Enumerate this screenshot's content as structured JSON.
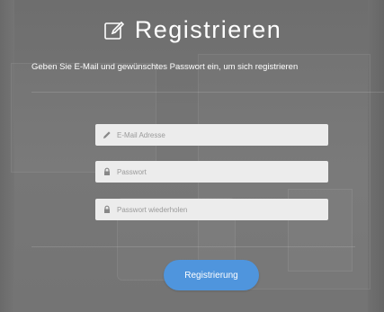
{
  "header": {
    "title": "Registrieren",
    "icon": "edit-icon"
  },
  "subtitle": "Geben Sie E-Mail und gewünschtes Passwort ein, um sich registrieren",
  "form": {
    "email": {
      "placeholder": "E-Mail Adresse",
      "value": "",
      "icon": "pencil-icon"
    },
    "password": {
      "placeholder": "Passwort",
      "value": "",
      "icon": "lock-icon"
    },
    "password_repeat": {
      "placeholder": "Passwort wiederholen",
      "value": "",
      "icon": "lock-icon"
    },
    "submit_label": "Registrierung"
  },
  "colors": {
    "background": "#777777",
    "input_background": "#ececec",
    "button": "#4f95dd",
    "text": "#ffffff"
  }
}
